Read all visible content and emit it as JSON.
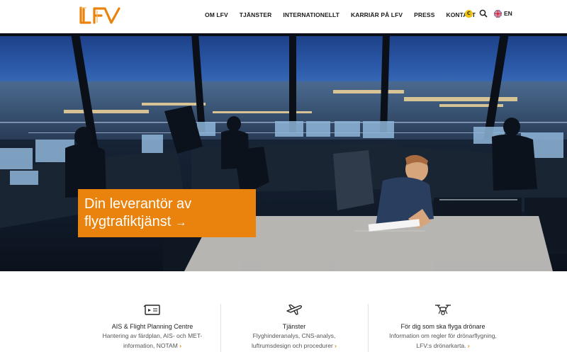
{
  "header": {
    "logo_text": "LFV",
    "nav": [
      "OM LFV",
      "TJÄNSTER",
      "INTERNATIONELLT",
      "KARRIÄR PÅ LFV",
      "PRESS",
      "KONTAKT"
    ],
    "cookie_badge": "C",
    "search_icon": "search-icon",
    "language_flag": "uk-flag-icon",
    "language": "EN"
  },
  "hero": {
    "headline_line1": "Din leverantör av",
    "headline_line2": "flygtrafiktjänst",
    "arrow": "→",
    "cta_color": "#e9830d"
  },
  "cards": [
    {
      "icon": "ticket-icon",
      "title": "AIS & Flight Planning Centre",
      "desc1": "Hantering av färdplan, AIS- och MET-",
      "desc2": "information, NOTAM",
      "more": "›"
    },
    {
      "icon": "airplane-icon",
      "title": "Tjänster",
      "desc1": "Flyghinderanalys, CNS-analys,",
      "desc2": "luftrumsdesign och procedurer",
      "more": "›"
    },
    {
      "icon": "drone-icon",
      "title": "För dig som ska flyga drönare",
      "desc1": "Information om regler för drönarflygning,",
      "desc2": "LFV:s drönarkarta.",
      "more": "›"
    }
  ],
  "colors": {
    "brand_orange": "#e9830d",
    "text_dark": "#1c1c1c"
  }
}
